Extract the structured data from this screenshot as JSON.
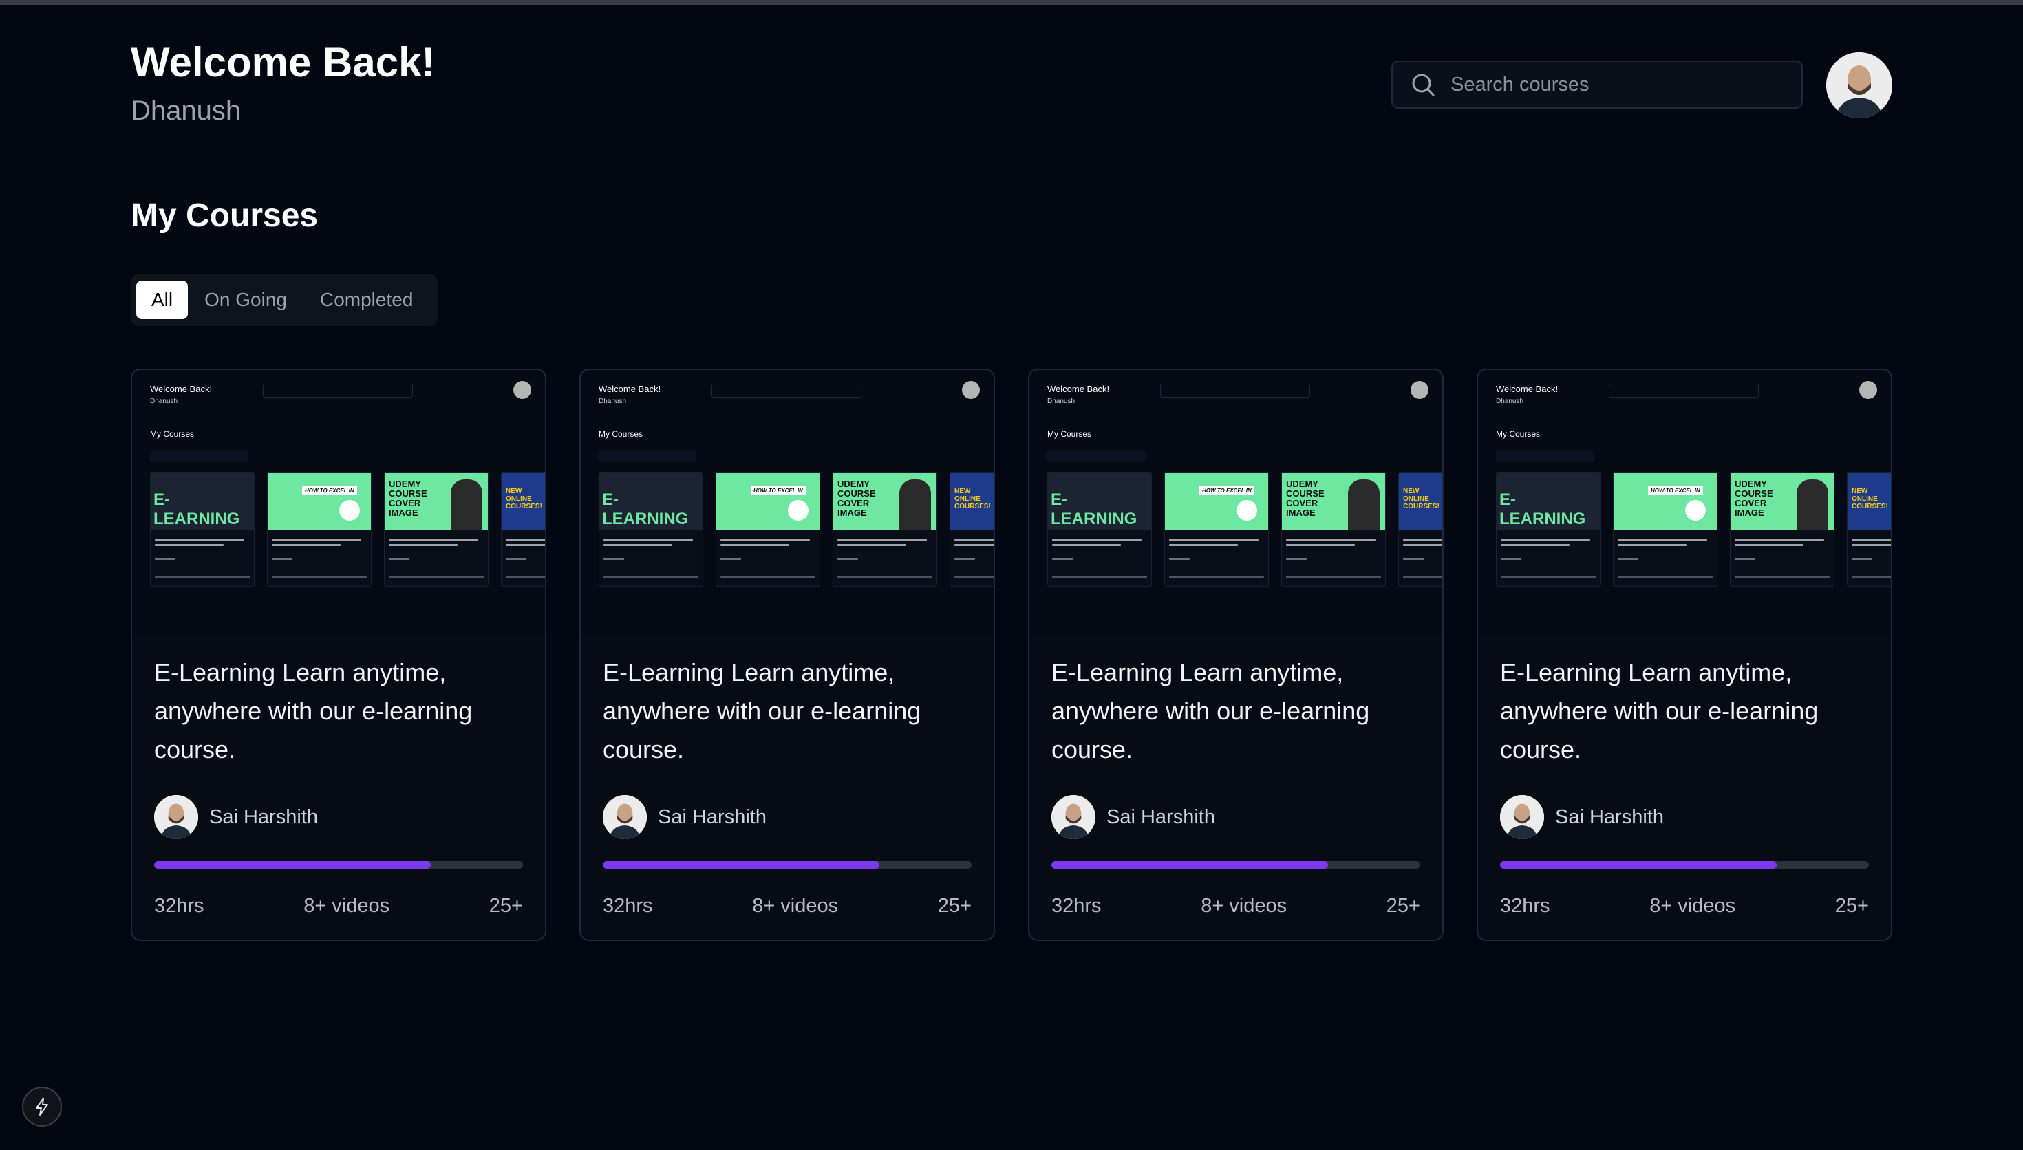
{
  "header": {
    "welcome": "Welcome Back!",
    "username": "Dhanush"
  },
  "search": {
    "placeholder": "Search courses"
  },
  "section": {
    "title": "My Courses"
  },
  "tabs": [
    {
      "label": "All",
      "active": true
    },
    {
      "label": "On Going",
      "active": false
    },
    {
      "label": "Completed",
      "active": false
    }
  ],
  "courses": [
    {
      "title": "E-Learning Learn anytime, anywhere with our e-learning course.",
      "author": "Sai Harshith",
      "progress_percent": 75,
      "duration": "32hrs",
      "videos": "8+ videos",
      "extra": "25+"
    },
    {
      "title": "E-Learning Learn anytime, anywhere with our e-learning course.",
      "author": "Sai Harshith",
      "progress_percent": 75,
      "duration": "32hrs",
      "videos": "8+ videos",
      "extra": "25+"
    },
    {
      "title": "E-Learning Learn anytime, anywhere with our e-learning course.",
      "author": "Sai Harshith",
      "progress_percent": 75,
      "duration": "32hrs",
      "videos": "8+ videos",
      "extra": "25+"
    },
    {
      "title": "E-Learning Learn anytime, anywhere with our e-learning course.",
      "author": "Sai Harshith",
      "progress_percent": 75,
      "duration": "32hrs",
      "videos": "8+ videos",
      "extra": "25+"
    }
  ],
  "thumbnail": {
    "welcome": "Welcome Back!",
    "username": "Dhanush",
    "section": "My Courses",
    "cover_labels": [
      "E-LEARNING",
      "HOW TO EXCEL IN",
      "UDEMY COURSE COVER IMAGE",
      "NEW ONLINE COURSES!"
    ]
  },
  "colors": {
    "background": "#030712",
    "accent": "#7c3aed",
    "cover_green": "#6ee7a0"
  },
  "icons": {
    "search": "search-icon",
    "bolt": "bolt-icon"
  }
}
